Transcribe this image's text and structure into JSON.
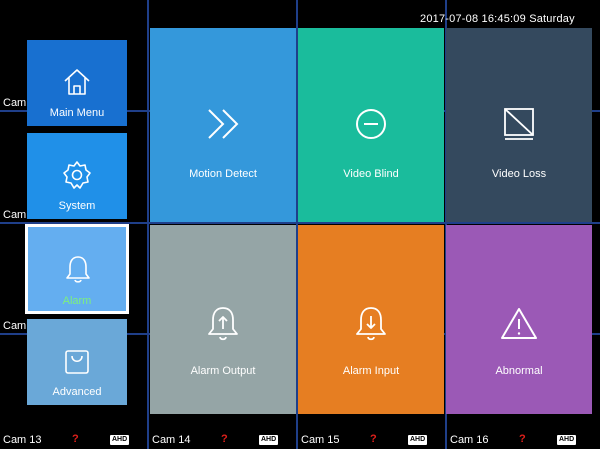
{
  "datetime": "2017-07-08 16:45:09  Saturday",
  "side_cam_labels": [
    "Cam",
    "Cam",
    "Cam"
  ],
  "bottom_cams": [
    {
      "name": "Cam 13",
      "status": "?",
      "badge": "AHD"
    },
    {
      "name": "Cam 14",
      "status": "?",
      "badge": "AHD"
    },
    {
      "name": "Cam 15",
      "status": "?",
      "badge": "AHD"
    },
    {
      "name": "Cam 16",
      "status": "?",
      "badge": "AHD"
    }
  ],
  "sidebar": {
    "items": [
      {
        "label": "Main Menu",
        "icon": "home-icon",
        "color": "#1870d0"
      },
      {
        "label": "System",
        "icon": "gear-icon",
        "color": "#2090e8"
      },
      {
        "label": "Alarm",
        "icon": "bell-icon",
        "color": "#64aef0",
        "active": true
      },
      {
        "label": "Advanced",
        "icon": "bag-icon",
        "color": "#6aa8d8"
      }
    ]
  },
  "tiles": [
    {
      "label": "Motion Detect",
      "icon": "double-chevron-right-icon",
      "color": "#3498db"
    },
    {
      "label": "Video Blind",
      "icon": "minus-circle-icon",
      "color": "#1abc9c"
    },
    {
      "label": "Video Loss",
      "icon": "video-loss-icon",
      "color": "#34495e"
    },
    {
      "label": "Alarm Output",
      "icon": "bell-up-icon",
      "color": "#95a5a6"
    },
    {
      "label": "Alarm Input",
      "icon": "bell-down-icon",
      "color": "#e67e22"
    },
    {
      "label": "Abnormal",
      "icon": "warning-icon",
      "color": "#9b59b6"
    }
  ]
}
